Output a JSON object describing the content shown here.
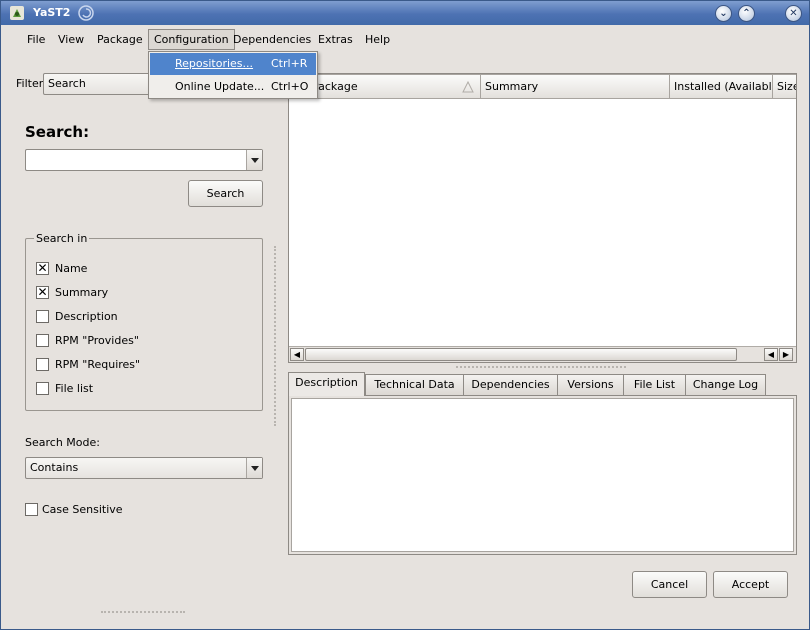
{
  "window": {
    "title": "YaST2",
    "btn_minimize": "⌄",
    "btn_maximize": "⌃",
    "btn_close": "✕"
  },
  "menubar": {
    "file": "File",
    "view": "View",
    "package": "Package",
    "configuration": "Configuration",
    "dependencies": "Dependencies",
    "extras": "Extras",
    "help": "Help"
  },
  "config_menu": {
    "items": [
      {
        "label": "Repositories...",
        "shortcut": "Ctrl+R"
      },
      {
        "label": "Online Update...",
        "shortcut": "Ctrl+O"
      }
    ]
  },
  "filter": {
    "label": "Filter:",
    "value": "Search"
  },
  "search": {
    "heading": "Search:",
    "input_value": "",
    "button": "Search",
    "search_in": {
      "legend": "Search in",
      "options": [
        {
          "label": "Name",
          "checked": true
        },
        {
          "label": "Summary",
          "checked": true
        },
        {
          "label": "Description",
          "checked": false
        },
        {
          "label": "RPM \"Provides\"",
          "checked": false
        },
        {
          "label": "RPM \"Requires\"",
          "checked": false
        },
        {
          "label": "File list",
          "checked": false
        }
      ]
    },
    "mode_label": "Search Mode:",
    "mode_value": "Contains",
    "case_sensitive": {
      "label": "Case Sensitive",
      "checked": false
    }
  },
  "table": {
    "columns": [
      "Package",
      "Summary",
      "Installed (Available)",
      "Size"
    ]
  },
  "details_tabs": [
    "Description",
    "Technical Data",
    "Dependencies",
    "Versions",
    "File List",
    "Change Log"
  ],
  "buttons": {
    "cancel": "Cancel",
    "accept": "Accept"
  },
  "colors": {
    "titlebar": "#4d72b3",
    "menu_highlight": "#4f84cc",
    "background": "#e6e2de"
  }
}
